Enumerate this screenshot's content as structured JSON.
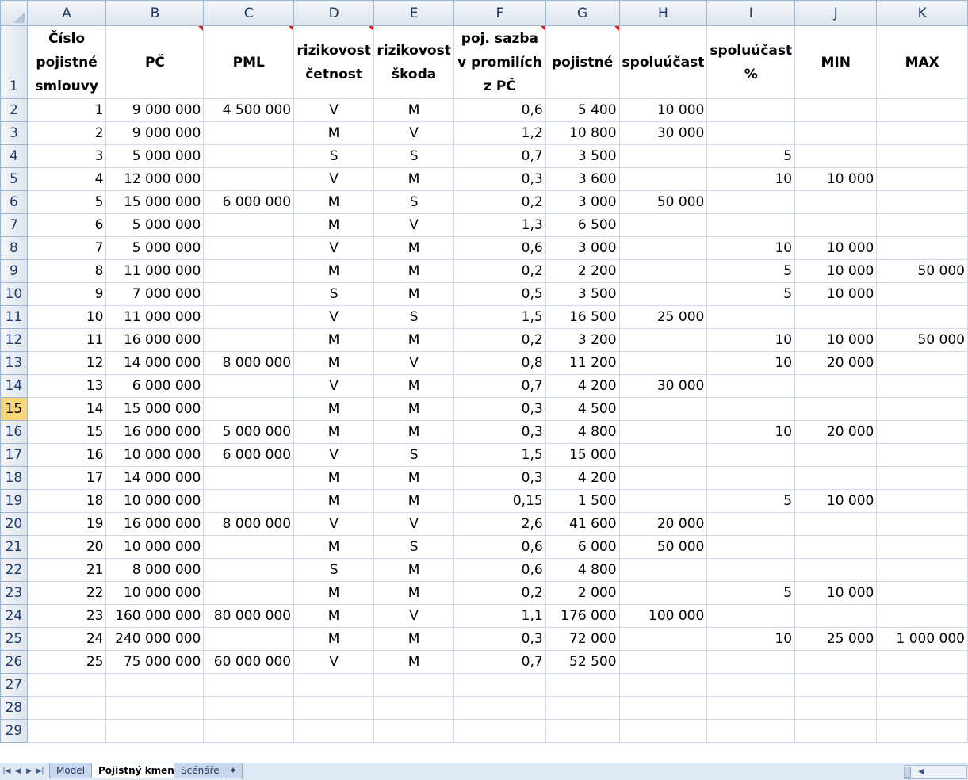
{
  "columns": [
    "A",
    "B",
    "C",
    "D",
    "E",
    "F",
    "G",
    "H",
    "I",
    "J",
    "K"
  ],
  "header_row": {
    "row_number": "1",
    "cells": [
      "Číslo pojistné smlouvy",
      "PČ",
      "PML",
      "rizikovost četnost",
      "rizikovost škoda",
      "poj. sazba v promilích z PČ",
      "pojistné",
      "spoluúčast",
      "spoluúčast %",
      "MIN",
      "MAX"
    ],
    "comment_marker_columns": [
      "B",
      "C",
      "D",
      "F",
      "G"
    ]
  },
  "rows": [
    {
      "n": "2",
      "c": [
        "1",
        "9 000 000",
        "4 500 000",
        "V",
        "M",
        "0,6",
        "5 400",
        "10 000",
        "",
        "",
        ""
      ]
    },
    {
      "n": "3",
      "c": [
        "2",
        "9 000 000",
        "",
        "M",
        "V",
        "1,2",
        "10 800",
        "30 000",
        "",
        "",
        ""
      ]
    },
    {
      "n": "4",
      "c": [
        "3",
        "5 000 000",
        "",
        "S",
        "S",
        "0,7",
        "3 500",
        "",
        "5",
        "",
        ""
      ]
    },
    {
      "n": "5",
      "c": [
        "4",
        "12 000 000",
        "",
        "V",
        "M",
        "0,3",
        "3 600",
        "",
        "10",
        "10 000",
        ""
      ]
    },
    {
      "n": "6",
      "c": [
        "5",
        "15 000 000",
        "6 000 000",
        "M",
        "S",
        "0,2",
        "3 000",
        "50 000",
        "",
        "",
        ""
      ]
    },
    {
      "n": "7",
      "c": [
        "6",
        "5 000 000",
        "",
        "M",
        "V",
        "1,3",
        "6 500",
        "",
        "",
        "",
        ""
      ]
    },
    {
      "n": "8",
      "c": [
        "7",
        "5 000 000",
        "",
        "V",
        "M",
        "0,6",
        "3 000",
        "",
        "10",
        "10 000",
        ""
      ]
    },
    {
      "n": "9",
      "c": [
        "8",
        "11 000 000",
        "",
        "M",
        "M",
        "0,2",
        "2 200",
        "",
        "5",
        "10 000",
        "50 000"
      ]
    },
    {
      "n": "10",
      "c": [
        "9",
        "7 000 000",
        "",
        "S",
        "M",
        "0,5",
        "3 500",
        "",
        "5",
        "10 000",
        ""
      ]
    },
    {
      "n": "11",
      "c": [
        "10",
        "11 000 000",
        "",
        "V",
        "S",
        "1,5",
        "16 500",
        "25 000",
        "",
        "",
        ""
      ]
    },
    {
      "n": "12",
      "c": [
        "11",
        "16 000 000",
        "",
        "M",
        "M",
        "0,2",
        "3 200",
        "",
        "10",
        "10 000",
        "50 000"
      ]
    },
    {
      "n": "13",
      "c": [
        "12",
        "14 000 000",
        "8 000 000",
        "M",
        "V",
        "0,8",
        "11 200",
        "",
        "10",
        "20 000",
        ""
      ]
    },
    {
      "n": "14",
      "c": [
        "13",
        "6 000 000",
        "",
        "V",
        "M",
        "0,7",
        "4 200",
        "30 000",
        "",
        "",
        ""
      ]
    },
    {
      "n": "15",
      "c": [
        "14",
        "15 000 000",
        "",
        "M",
        "M",
        "0,3",
        "4 500",
        "",
        "",
        "",
        ""
      ],
      "active": true
    },
    {
      "n": "16",
      "c": [
        "15",
        "16 000 000",
        "5 000 000",
        "M",
        "M",
        "0,3",
        "4 800",
        "",
        "10",
        "20 000",
        ""
      ]
    },
    {
      "n": "17",
      "c": [
        "16",
        "10 000 000",
        "6 000 000",
        "V",
        "S",
        "1,5",
        "15 000",
        "",
        "",
        "",
        ""
      ]
    },
    {
      "n": "18",
      "c": [
        "17",
        "14 000 000",
        "",
        "M",
        "M",
        "0,3",
        "4 200",
        "",
        "",
        "",
        ""
      ]
    },
    {
      "n": "19",
      "c": [
        "18",
        "10 000 000",
        "",
        "M",
        "M",
        "0,15",
        "1 500",
        "",
        "5",
        "10 000",
        ""
      ]
    },
    {
      "n": "20",
      "c": [
        "19",
        "16 000 000",
        "8 000 000",
        "V",
        "V",
        "2,6",
        "41 600",
        "20 000",
        "",
        "",
        ""
      ]
    },
    {
      "n": "21",
      "c": [
        "20",
        "10 000 000",
        "",
        "M",
        "S",
        "0,6",
        "6 000",
        "50 000",
        "",
        "",
        ""
      ]
    },
    {
      "n": "22",
      "c": [
        "21",
        "8 000 000",
        "",
        "S",
        "M",
        "0,6",
        "4 800",
        "",
        "",
        "",
        ""
      ]
    },
    {
      "n": "23",
      "c": [
        "22",
        "10 000 000",
        "",
        "M",
        "M",
        "0,2",
        "2 000",
        "",
        "5",
        "10 000",
        ""
      ]
    },
    {
      "n": "24",
      "c": [
        "23",
        "160 000 000",
        "80 000 000",
        "M",
        "V",
        "1,1",
        "176 000",
        "100 000",
        "",
        "",
        ""
      ]
    },
    {
      "n": "25",
      "c": [
        "24",
        "240 000 000",
        "",
        "M",
        "M",
        "0,3",
        "72 000",
        "",
        "10",
        "25 000",
        "1 000 000"
      ]
    },
    {
      "n": "26",
      "c": [
        "25",
        "75 000 000",
        "60 000 000",
        "V",
        "M",
        "0,7",
        "52 500",
        "",
        "",
        "",
        ""
      ]
    },
    {
      "n": "27",
      "c": [
        "",
        "",
        "",
        "",
        "",
        "",
        "",
        "",
        "",
        "",
        ""
      ]
    },
    {
      "n": "28",
      "c": [
        "",
        "",
        "",
        "",
        "",
        "",
        "",
        "",
        "",
        "",
        ""
      ]
    },
    {
      "n": "29",
      "c": [
        "",
        "",
        "",
        "",
        "",
        "",
        "",
        "",
        "",
        "",
        ""
      ]
    }
  ],
  "sheet_tabs": [
    {
      "label": "Model",
      "active": false
    },
    {
      "label": "Pojistný kmen",
      "active": true
    },
    {
      "label": "Scénáře",
      "active": false
    }
  ],
  "icons": {
    "nav": [
      "first-sheet-icon",
      "prev-sheet-icon",
      "next-sheet-icon",
      "last-sheet-icon"
    ],
    "new_sheet": "insert-sheet-icon"
  }
}
